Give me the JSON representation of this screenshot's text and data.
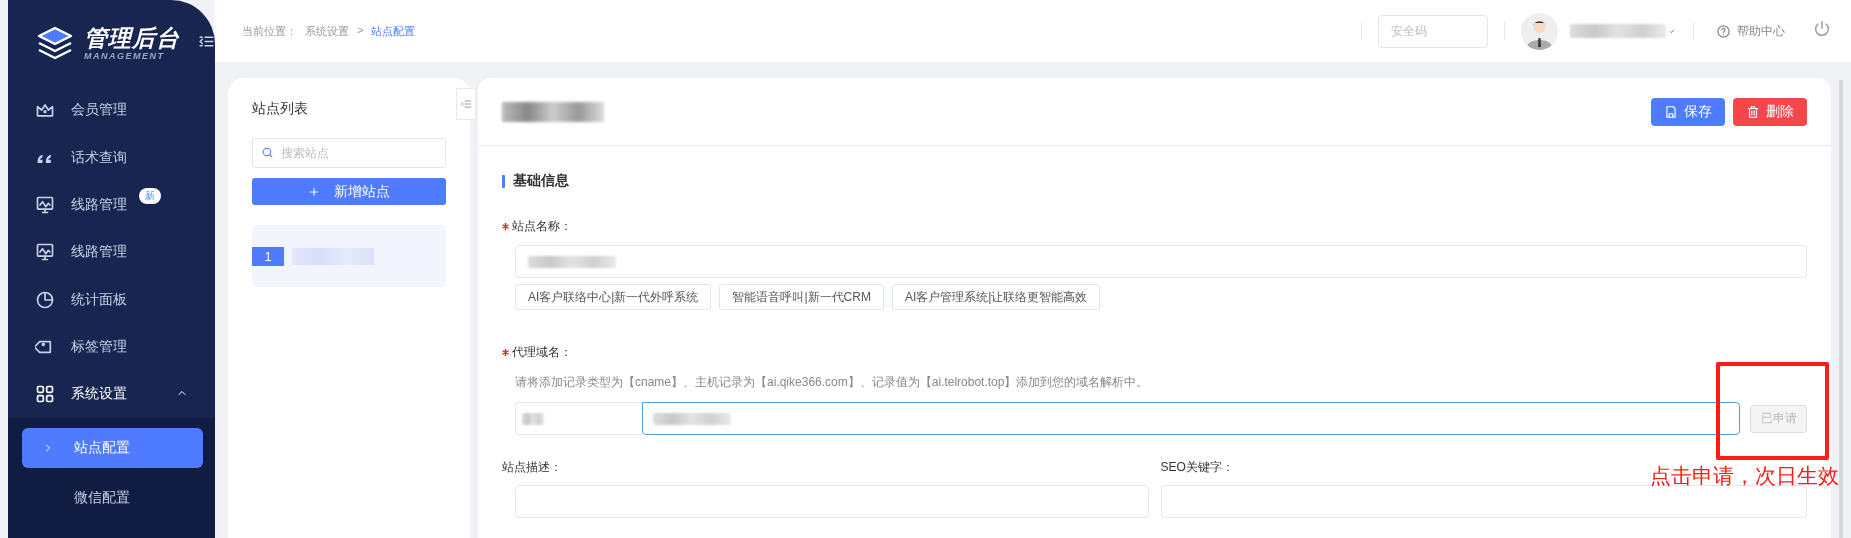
{
  "sidebar": {
    "logo": {
      "title": "管理后台",
      "subtitle": "MANAGEMENT"
    },
    "items": [
      {
        "label": "会员管理",
        "selected": false
      },
      {
        "label": "话术查询",
        "selected": false
      },
      {
        "label": "线路管理",
        "selected": false,
        "badge": "新"
      },
      {
        "label": "线路管理",
        "selected": false
      },
      {
        "label": "统计面板",
        "selected": false
      },
      {
        "label": "标签管理",
        "selected": false
      },
      {
        "label": "系统设置",
        "selected": false,
        "expanded": true,
        "children": [
          {
            "label": "站点配置",
            "selected": true
          },
          {
            "label": "微信配置",
            "selected": false
          }
        ]
      }
    ]
  },
  "breadcrumb": {
    "label": "当前位置：",
    "items": [
      "系统设置",
      "站点配置"
    ],
    "separator": ">"
  },
  "header": {
    "security_code": {
      "placeholder": "安全码"
    },
    "help": "帮助中心"
  },
  "site_list": {
    "title": "站点列表",
    "search": {
      "placeholder": "搜索站点"
    },
    "add_button": "新增站点",
    "sites": [
      {
        "index": "1",
        "selected": true
      }
    ]
  },
  "editor": {
    "save_button": "保存",
    "delete_button": "删除",
    "section_title": "基础信息",
    "site_name": {
      "label": "站点名称：",
      "required": true,
      "suggestions": [
        "AI客户联络中心|新一代外呼系统",
        "智能语音呼叫|新一代CRM",
        "AI客户管理系统|让联络更智能高效"
      ]
    },
    "domain": {
      "label": "代理域名：",
      "required": true,
      "hint": "请将添加记录类型为【cname】、主机记录为【ai.qike366.com】、记录值为【ai.telrobot.top】添加到您的域名解析中。",
      "apply_button": {
        "label": "已申请",
        "disabled": true
      }
    },
    "description": {
      "label": "站点描述：",
      "required": false
    },
    "seo_keywords": {
      "label": "SEO关键字：",
      "required": false
    }
  },
  "annotation": "点击申请，次日生效"
}
